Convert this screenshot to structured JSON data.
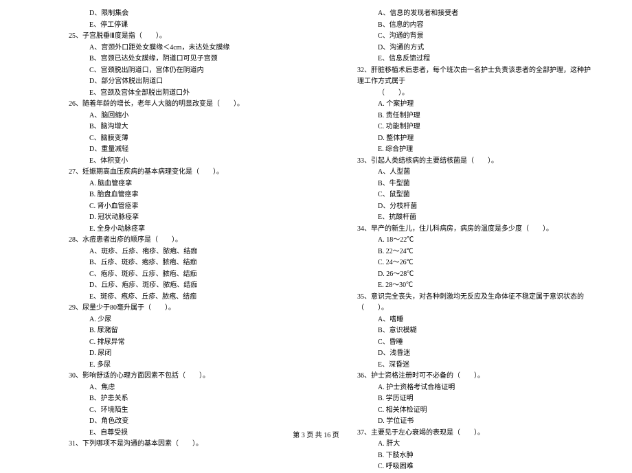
{
  "left": [
    {
      "cls": "opt",
      "t": "D、限制集会"
    },
    {
      "cls": "opt",
      "t": "E、停工停课"
    },
    {
      "cls": "q",
      "t": "25、子宫脱垂Ⅲ度是指（　　）。"
    },
    {
      "cls": "opt",
      "t": "A、宫颈外口距处女膜缘＜4cm，未达处女膜缘"
    },
    {
      "cls": "opt",
      "t": "B、宫颈已达处女膜缘，阴道口可见子宫颈"
    },
    {
      "cls": "opt",
      "t": "C、宫颈脱出阴道口，宫体仍在阴道内"
    },
    {
      "cls": "opt",
      "t": "D、部分宫体脱出阴道口"
    },
    {
      "cls": "opt",
      "t": "E、宫颈及宫体全部脱出阴道口外"
    },
    {
      "cls": "q",
      "t": "26、随着年龄的增长，老年人大脑的明显改变是（　　）。"
    },
    {
      "cls": "opt",
      "t": "A、脑回缩小"
    },
    {
      "cls": "opt",
      "t": "B、脑沟增大"
    },
    {
      "cls": "opt",
      "t": "C、脑膜变薄"
    },
    {
      "cls": "opt",
      "t": "D、重量减轻"
    },
    {
      "cls": "opt",
      "t": "E、体积变小"
    },
    {
      "cls": "q",
      "t": "27、妊娠期高血压疾病的基本病理变化是（　　）。"
    },
    {
      "cls": "opt",
      "t": "A. 脑血管痉挛"
    },
    {
      "cls": "opt",
      "t": "B. 胎盘血管痉挛"
    },
    {
      "cls": "opt",
      "t": "C. 肾小血管痉挛"
    },
    {
      "cls": "opt",
      "t": "D. 冠状动脉痉挛"
    },
    {
      "cls": "opt",
      "t": "E. 全身小动脉痉挛"
    },
    {
      "cls": "q",
      "t": "28、水痘患者出疹的顺序是（　　）。"
    },
    {
      "cls": "opt",
      "t": "A、斑疹、丘疹、疱疹、脓疱、结痂"
    },
    {
      "cls": "opt",
      "t": "B、丘疹、斑疹、疱疹、脓疱、结痂"
    },
    {
      "cls": "opt",
      "t": "C、疱疹、斑疹、丘疹、脓疱、结痂"
    },
    {
      "cls": "opt",
      "t": "D、丘疹、疱疹、斑疹、脓疱、结痂"
    },
    {
      "cls": "opt",
      "t": "E、斑疹、疱疹、丘疹、脓疱、结痂"
    },
    {
      "cls": "q",
      "t": "29、尿量少于80毫升属于（　　）。"
    },
    {
      "cls": "opt",
      "t": "A. 少尿"
    },
    {
      "cls": "opt",
      "t": "B. 尿潴留"
    },
    {
      "cls": "opt",
      "t": "C. 排尿异常"
    },
    {
      "cls": "opt",
      "t": "D. 尿闭"
    },
    {
      "cls": "opt",
      "t": "E. 多尿"
    },
    {
      "cls": "q",
      "t": "30、影响舒适的心理方面因素不包括（　　）。"
    },
    {
      "cls": "opt",
      "t": "A、焦虑"
    },
    {
      "cls": "opt",
      "t": "B、护患关系"
    },
    {
      "cls": "opt",
      "t": "C、环境陌生"
    },
    {
      "cls": "opt",
      "t": "D、角色改变"
    },
    {
      "cls": "opt",
      "t": "E、自尊受损"
    },
    {
      "cls": "q",
      "t": "31、下列哪项不是沟通的基本因素（　　）。"
    }
  ],
  "right": [
    {
      "cls": "opt",
      "t": "A、信息的发现者和接受者"
    },
    {
      "cls": "opt",
      "t": "B、信息的内容"
    },
    {
      "cls": "opt",
      "t": "C、沟通的背景"
    },
    {
      "cls": "opt",
      "t": "D、沟通的方式"
    },
    {
      "cls": "opt",
      "t": "E、信息反馈过程"
    },
    {
      "cls": "q",
      "t": "32、肝脏移植术后患者，每个班次由一名护士负责该患者的全部护理，这种护理工作方式属于"
    },
    {
      "cls": "opt",
      "t": "（　　）。"
    },
    {
      "cls": "opt",
      "t": "A. 个案护理"
    },
    {
      "cls": "opt",
      "t": "B. 责任制护理"
    },
    {
      "cls": "opt",
      "t": "C. 功能制护理"
    },
    {
      "cls": "opt",
      "t": "D. 整体护理"
    },
    {
      "cls": "opt",
      "t": "E. 综合护理"
    },
    {
      "cls": "q",
      "t": "33、引起人类结核病的主要结核菌是（　　）。"
    },
    {
      "cls": "opt",
      "t": "A、人型菌"
    },
    {
      "cls": "opt",
      "t": "B、牛型菌"
    },
    {
      "cls": "opt",
      "t": "C、鼠型菌"
    },
    {
      "cls": "opt",
      "t": "D、分枝杆菌"
    },
    {
      "cls": "opt",
      "t": "E、抗酸杆菌"
    },
    {
      "cls": "q",
      "t": "34、早产的新生儿，住儿科病房，病房的温度是多少度（　　）。"
    },
    {
      "cls": "opt",
      "t": "A. 18～22℃"
    },
    {
      "cls": "opt",
      "t": "B. 22～24℃"
    },
    {
      "cls": "opt",
      "t": "C. 24～26℃"
    },
    {
      "cls": "opt",
      "t": "D. 26～28℃"
    },
    {
      "cls": "opt",
      "t": "E. 28～30℃"
    },
    {
      "cls": "q",
      "t": "35、意识完全丧失，对各种刺激均无反应及生命体征不稳定属于意识状态的（　　）。"
    },
    {
      "cls": "opt",
      "t": "A、嗜睡"
    },
    {
      "cls": "opt",
      "t": "B、意识模糊"
    },
    {
      "cls": "opt",
      "t": "C、昏睡"
    },
    {
      "cls": "opt",
      "t": "D、浅昏迷"
    },
    {
      "cls": "opt",
      "t": "E、深昏迷"
    },
    {
      "cls": "q",
      "t": "36、护士资格注册时可不必备的（　　）。"
    },
    {
      "cls": "opt",
      "t": "A. 护士资格考试合格证明"
    },
    {
      "cls": "opt",
      "t": "B. 学历证明"
    },
    {
      "cls": "opt",
      "t": "C. 相关体检证明"
    },
    {
      "cls": "opt",
      "t": "D. 学位证书"
    },
    {
      "cls": "q",
      "t": "37、主要见于左心衰竭的表现是（　　）。"
    },
    {
      "cls": "opt",
      "t": "A. 肝大"
    },
    {
      "cls": "opt",
      "t": "B. 下肢水肿"
    },
    {
      "cls": "opt",
      "t": "C. 呼吸困难"
    }
  ],
  "footer": "第 3 页 共 16 页"
}
